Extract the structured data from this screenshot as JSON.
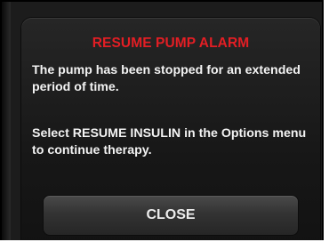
{
  "alert": {
    "title": "RESUME PUMP ALARM",
    "message_line1": "The pump has been stopped for an extended period of time.",
    "message_line2": "Select RESUME INSULIN in the Options menu to continue therapy.",
    "close_label": "CLOSE"
  },
  "colors": {
    "title": "#e31e24",
    "background": "#1c1c1c",
    "text": "#f2f2f2"
  }
}
